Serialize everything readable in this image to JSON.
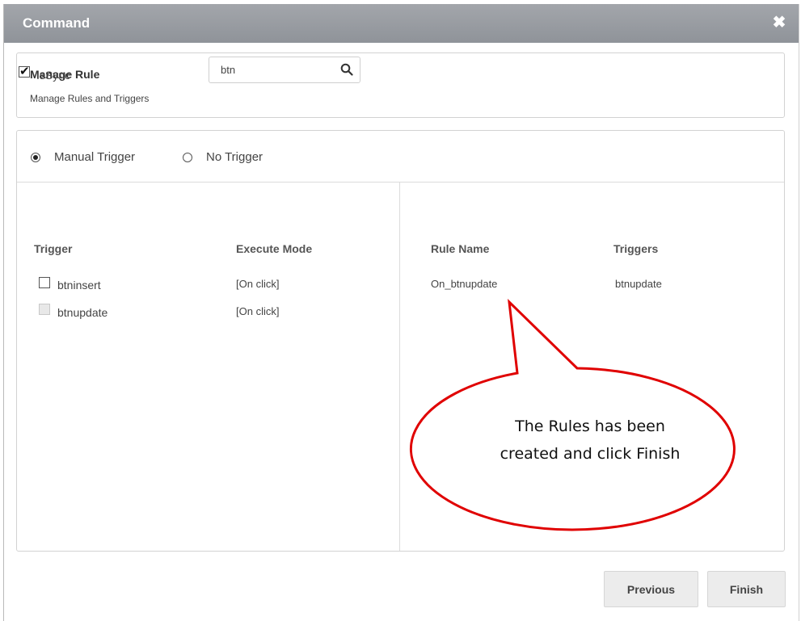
{
  "dialog": {
    "title": "Command",
    "close_icon": "close-icon"
  },
  "header": {
    "title": "Manage Rule",
    "subtitle": "Manage Rules and Triggers"
  },
  "trigger_mode": {
    "options": [
      {
        "label": "Manual Trigger",
        "selected": true
      },
      {
        "label": "No Trigger",
        "selected": false
      }
    ]
  },
  "left": {
    "is_sync": {
      "label": "IsSync",
      "checked": true
    },
    "search": {
      "value": "btn",
      "icon": "search-icon"
    },
    "columns": [
      "Trigger",
      "Execute Mode"
    ],
    "rows": [
      {
        "trigger": "btninsert",
        "mode": "[On click]",
        "checked": false,
        "disabled": false
      },
      {
        "trigger": "btnupdate",
        "mode": "[On click]",
        "checked": false,
        "disabled": true
      }
    ]
  },
  "right": {
    "columns": [
      "Rule Name",
      "Triggers"
    ],
    "rows": [
      {
        "rule_name": "On_btnupdate",
        "triggers": "btnupdate"
      }
    ]
  },
  "callout": {
    "line1": "The Rules has been",
    "line2": "created and click Finish",
    "color": "#e00000"
  },
  "footer": {
    "previous_label": "Previous",
    "finish_label": "Finish"
  }
}
